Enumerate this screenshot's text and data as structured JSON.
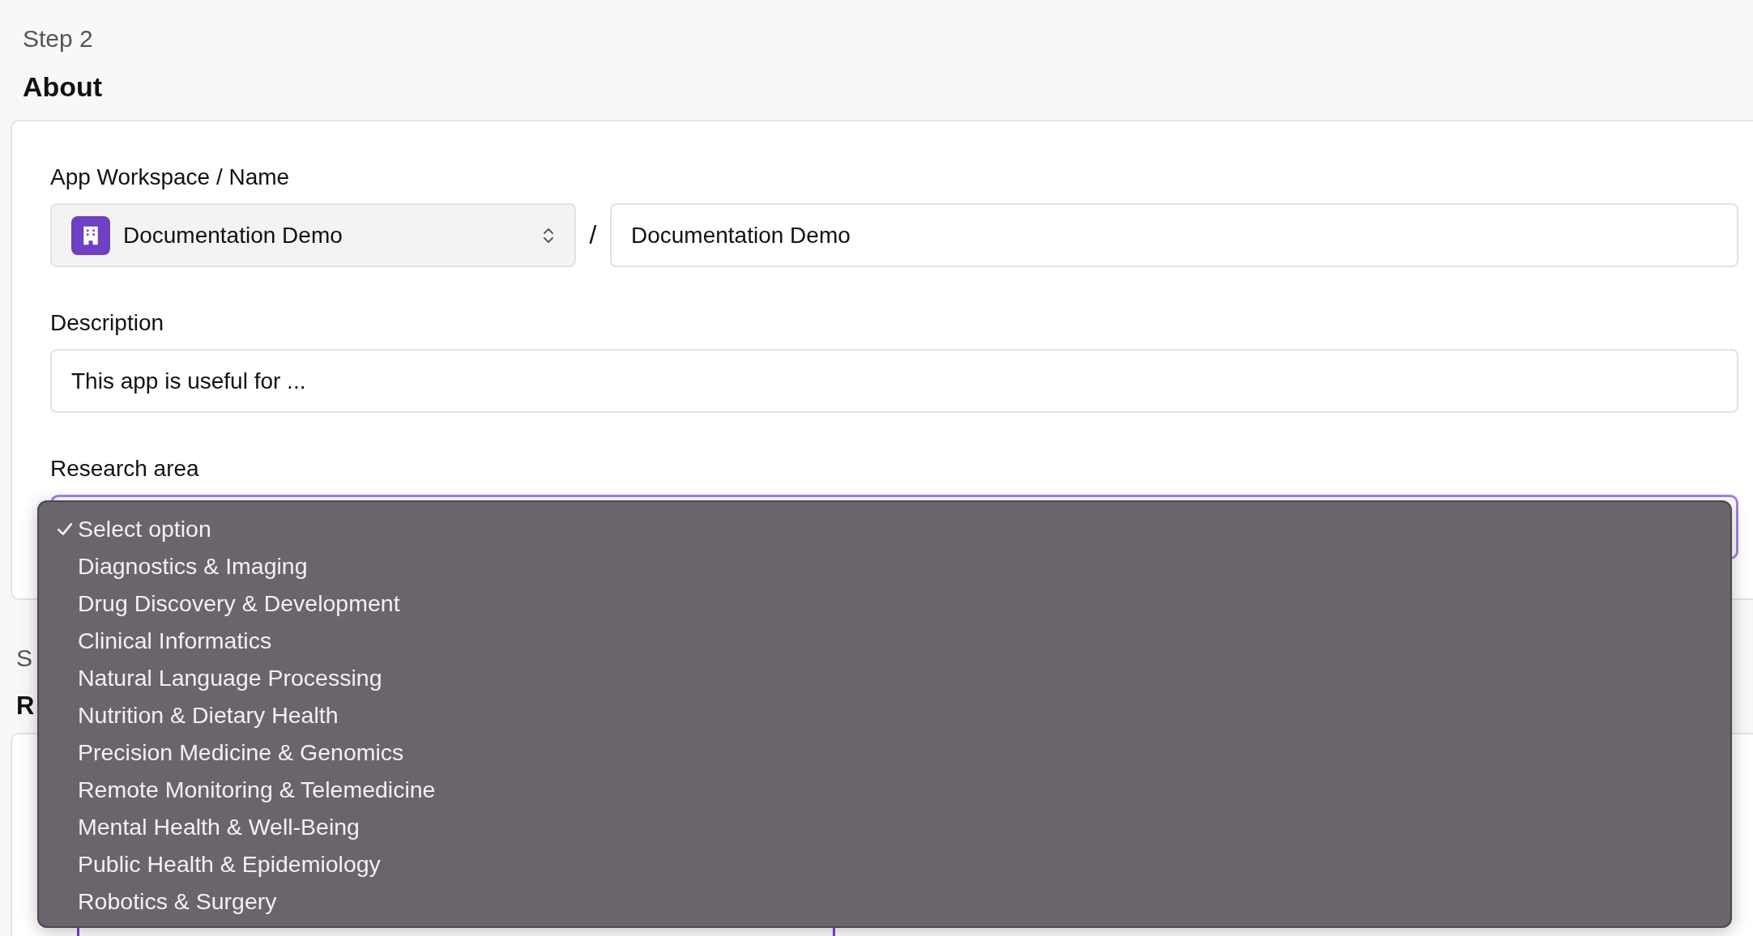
{
  "header": {
    "step": "Step 2",
    "title": "About"
  },
  "fields": [
    {
      "kind": "workspace_name",
      "label": "App Workspace / Name",
      "workspace": "Documentation Demo",
      "separator": "/",
      "name": "Documentation Demo"
    },
    {
      "kind": "text",
      "label": "Description",
      "value": "This app is useful for ..."
    },
    {
      "kind": "select",
      "label": "Research area",
      "focused": true
    }
  ],
  "dropdown": {
    "options": [
      {
        "label": "Select option",
        "selected": true
      },
      {
        "label": "Diagnostics & Imaging",
        "selected": false
      },
      {
        "label": "Drug Discovery & Development",
        "selected": false
      },
      {
        "label": "Clinical Informatics",
        "selected": false
      },
      {
        "label": "Natural Language Processing",
        "selected": false
      },
      {
        "label": "Nutrition & Dietary Health",
        "selected": false
      },
      {
        "label": "Precision Medicine & Genomics",
        "selected": false
      },
      {
        "label": "Remote Monitoring & Telemedicine",
        "selected": false
      },
      {
        "label": "Mental Health & Well-Being",
        "selected": false
      },
      {
        "label": "Public Health & Epidemiology",
        "selected": false
      },
      {
        "label": "Robotics & Surgery",
        "selected": false
      }
    ]
  },
  "next_section": {
    "step": "S",
    "title": "R"
  }
}
